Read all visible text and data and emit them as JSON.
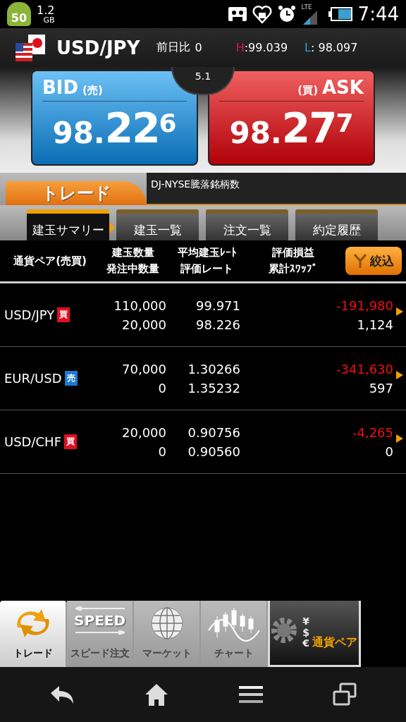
{
  "status_bar": {
    "badge": "50",
    "memory": "1.2",
    "memory_unit": "GB",
    "network": "LTE",
    "time": "7:44"
  },
  "header": {
    "pair": "USD/JPY",
    "change_label": "前日比",
    "change": "0",
    "high_label": "H",
    "high": ":99.039",
    "low_label": "L",
    "low": ": 98.097"
  },
  "quote": {
    "spread": "5.1",
    "bid": {
      "label": "BID",
      "side": "(売)",
      "prefix": "98.",
      "big": "22",
      "pip": "6"
    },
    "ask": {
      "label": "ASK",
      "side": "(買)",
      "prefix": "98.",
      "big": "27",
      "pip": "7"
    }
  },
  "section": {
    "title": "トレード",
    "ticker": "DJ-NYSE騰落銘柄数"
  },
  "tabs": [
    {
      "label": "建玉サマリー",
      "selected": true
    },
    {
      "label": "建玉一覧",
      "selected": false
    },
    {
      "label": "注文一覧",
      "selected": false
    },
    {
      "label": "約定履歴",
      "selected": false
    }
  ],
  "table": {
    "columns": [
      {
        "top": "通貨ペア(売買)"
      },
      {
        "top": "建玉数量",
        "bottom": "発注中数量"
      },
      {
        "top": "平均建玉ﾚｰﾄ",
        "bottom": "評価レート"
      },
      {
        "top": "評価損益",
        "bottom": "累計ｽﾜｯﾌﾟ"
      }
    ],
    "filter_button": "絞込",
    "rows": [
      {
        "pair": "USD/JPY",
        "kind": "buy",
        "side_label": "買",
        "quantity": "110,000",
        "pending": "20,000",
        "avg_rate": "99.971",
        "eval_rate": "98.226",
        "pl": "-191,980",
        "negative": true,
        "swap": "1,124"
      },
      {
        "pair": "EUR/USD",
        "kind": "sell",
        "side_label": "売",
        "quantity": "70,000",
        "pending": "0",
        "avg_rate": "1.30266",
        "eval_rate": "1.35232",
        "pl": "-341,630",
        "negative": true,
        "swap": "597"
      },
      {
        "pair": "USD/CHF",
        "kind": "buy",
        "side_label": "買",
        "quantity": "20,000",
        "pending": "0",
        "avg_rate": "0.90756",
        "eval_rate": "0.90560",
        "pl": "-4,265",
        "negative": true,
        "swap": "0"
      }
    ]
  },
  "bottom_nav": [
    {
      "kind": "trade",
      "label": "トレード",
      "selected": true
    },
    {
      "kind": "speed",
      "label": "スピード注文",
      "icon_text": "SPEED",
      "selected": false
    },
    {
      "kind": "market",
      "label": "マーケット",
      "selected": false
    },
    {
      "kind": "chart",
      "label": "チャート",
      "selected": false
    },
    {
      "kind": "pair",
      "label": "通貨ペア",
      "symbols": [
        "¥",
        "$",
        "€"
      ],
      "selected": false
    }
  ]
}
